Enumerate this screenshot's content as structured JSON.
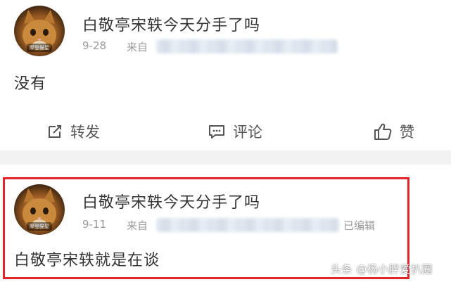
{
  "post1": {
    "username": "白敬亭宋轶今天分手了吗",
    "date": "9-28",
    "from_label": "来自",
    "content": "没有",
    "avatar_tag": "摩登猫星",
    "actions": {
      "repost_label": "转发",
      "comment_label": "评论",
      "like_label": "赞"
    }
  },
  "post2": {
    "username": "白敬亭宋轶今天分手了吗",
    "date": "9-11",
    "from_label": "来自",
    "edited_label": "已编辑",
    "content": "白敬亭宋轶就是在谈",
    "avatar_tag": "摩登猫星"
  },
  "watermark": "头条 @杨小胖爱扒圈",
  "colors": {
    "highlight_border": "#e0262b",
    "separator": "#f2f2f2",
    "meta_text": "#9a9a9a"
  }
}
